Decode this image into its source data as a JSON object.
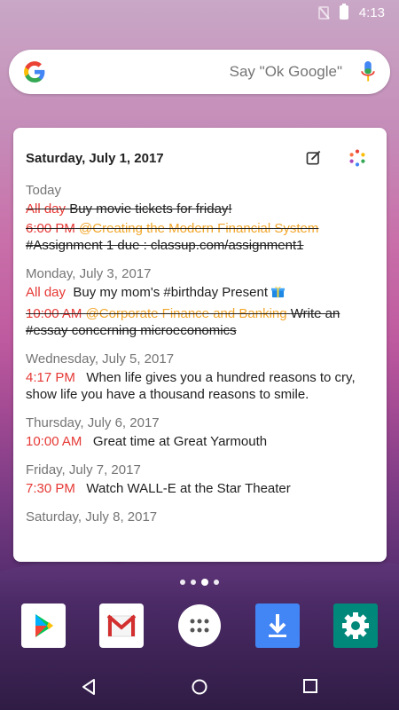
{
  "status_bar": {
    "time": "4:13"
  },
  "search": {
    "placeholder": "Say \"Ok Google\""
  },
  "widget": {
    "title": "Saturday, July 1, 2017",
    "days": [
      {
        "label": "Today",
        "events": [
          {
            "time": "All day",
            "text": "Buy movie tickets for friday!"
          },
          {
            "time": "6:00 PM",
            "calendar": "@Creating the Modern Financial System",
            "text": "#Assignment 1 due : classup.com/assignment1"
          }
        ]
      },
      {
        "label": "Monday, July 3, 2017",
        "events": [
          {
            "time": "All day",
            "text": "Buy my mom's  #birthday Present"
          },
          {
            "time": "10:00 AM",
            "calendar": "@Corporate Finance and Banking",
            "text": "Write an #essay concerning microeconomics"
          }
        ]
      },
      {
        "label": "Wednesday, July 5, 2017",
        "events": [
          {
            "time": "4:17 PM",
            "text": "When life gives you a hundred reasons to cry, show life you have a thousand reasons to smile."
          }
        ]
      },
      {
        "label": "Thursday, July 6, 2017",
        "events": [
          {
            "time": "10:00 AM",
            "text": "Great time at Great Yarmouth"
          }
        ]
      },
      {
        "label": "Friday, July 7, 2017",
        "events": [
          {
            "time": "7:30 PM",
            "text": "Watch WALL-E at the Star Theater"
          }
        ]
      },
      {
        "label": "Saturday, July 8, 2017",
        "events": []
      }
    ]
  },
  "dock": [
    {
      "name": "play-store-icon"
    },
    {
      "name": "gmail-icon"
    },
    {
      "name": "app-drawer-icon"
    },
    {
      "name": "downloads-icon"
    },
    {
      "name": "settings-icon"
    }
  ],
  "colors": {
    "time": "#e53935",
    "calendar": "#f2a62a",
    "accent_green": "#00897b",
    "download_blue": "#4285f4"
  }
}
